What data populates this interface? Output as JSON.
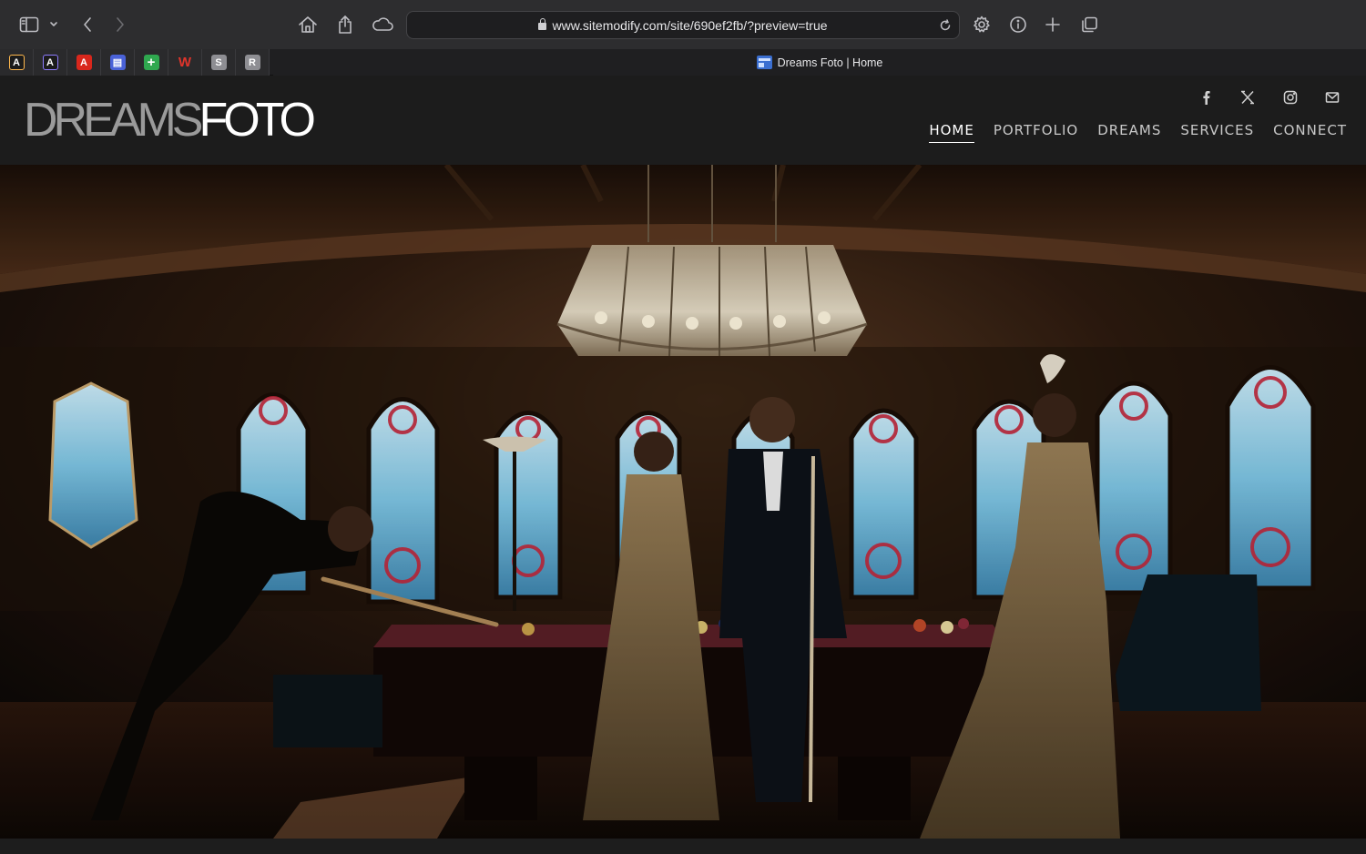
{
  "browser": {
    "url": "www.sitemodify.com/site/690ef2fb/?preview=true",
    "pinned_tabs": [
      {
        "icon": "adobe-creative-icon",
        "glyph": "A",
        "color": "#1b1b1b"
      },
      {
        "icon": "adobe-creative-icon",
        "glyph": "A",
        "color": "#1b1b1b"
      },
      {
        "icon": "adobe-acrobat-icon",
        "glyph": "A",
        "color": "#d9271c"
      },
      {
        "icon": "calendar-app-icon",
        "glyph": "▤",
        "color": "#4a62d8"
      },
      {
        "icon": "plus-green-app-icon",
        "glyph": "+",
        "color": "#2fa84f"
      },
      {
        "icon": "w-app-icon",
        "glyph": "W",
        "color": "transparent"
      },
      {
        "icon": "s-app-icon",
        "glyph": "S",
        "color": "#8e8e93"
      },
      {
        "icon": "r-app-icon",
        "glyph": "R",
        "color": "#8e8e93"
      }
    ],
    "active_tab_title": "Dreams Foto | Home"
  },
  "site": {
    "logo_part1": "DREAMS",
    "logo_part2": "FOTO",
    "social": [
      "facebook-icon",
      "x-twitter-icon",
      "instagram-icon",
      "mail-icon"
    ],
    "nav": [
      {
        "label": "HOME",
        "active": true
      },
      {
        "label": "PORTFOLIO",
        "active": false
      },
      {
        "label": "DREAMS",
        "active": false
      },
      {
        "label": "SERVICES",
        "active": false
      },
      {
        "label": "CONNECT",
        "active": false
      }
    ],
    "hero_description_colors": {
      "accent": "#ffffff",
      "header_bg": "#1c1c1c"
    }
  }
}
